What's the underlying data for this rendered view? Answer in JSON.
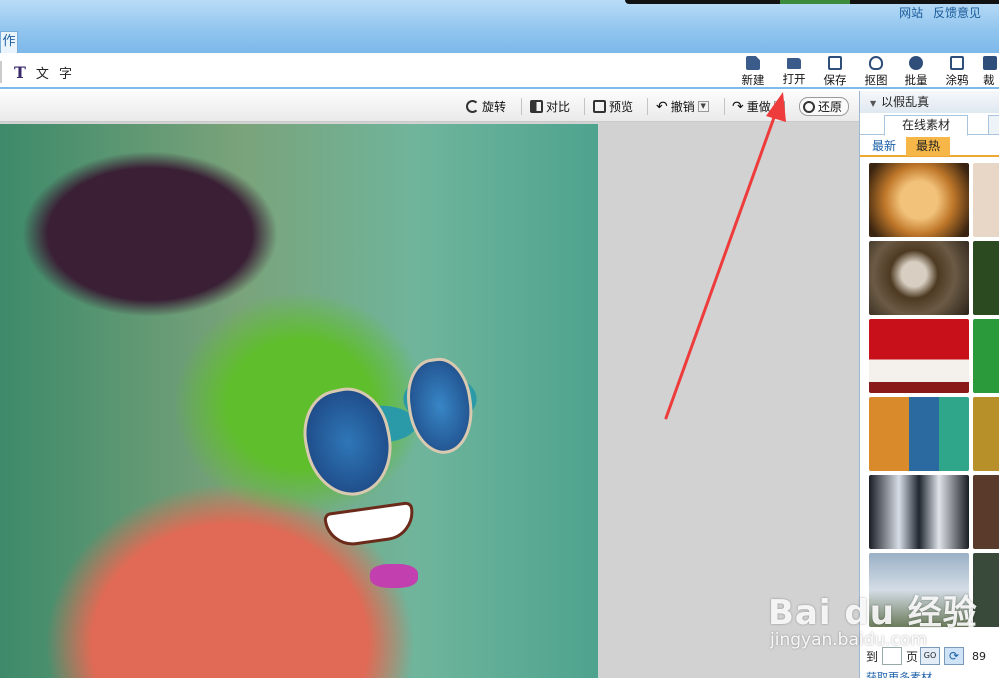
{
  "title_bar": {
    "top_links": [
      "网站",
      "反馈意见"
    ],
    "active_tab_label": "作"
  },
  "toolbar": {
    "text_tool_label": "文 字",
    "buttons": [
      {
        "label": "新建",
        "icon": "new-file-icon"
      },
      {
        "label": "打开",
        "icon": "folder-open-icon"
      },
      {
        "label": "保存",
        "icon": "save-icon"
      },
      {
        "label": "抠图",
        "icon": "cutout-icon"
      },
      {
        "label": "批量",
        "icon": "batch-icon"
      },
      {
        "label": "涂鸦",
        "icon": "graffiti-icon"
      },
      {
        "label": "裁",
        "icon": "crop-icon"
      }
    ]
  },
  "subbar": {
    "rotate": "旋转",
    "compare": "对比",
    "preview": "预览",
    "undo": "撤销",
    "redo": "重做",
    "restore": "还原"
  },
  "right_panel": {
    "header": "以假乱真",
    "tab": "在线素材",
    "subtabs": [
      "最新",
      "最热"
    ],
    "active_subtab": "最热",
    "pager": {
      "to_label": "到",
      "page_label": "页",
      "go_label": "GO",
      "count": "89"
    },
    "more_link": "获取更多素材..."
  },
  "watermark": {
    "logo": "Bai du 经验",
    "site": "jingyan.baidu.com"
  },
  "colors": {
    "accent": "#7db8ea",
    "annotation_arrow": "#ee3b3b",
    "hot_tab": "#f6b748"
  }
}
